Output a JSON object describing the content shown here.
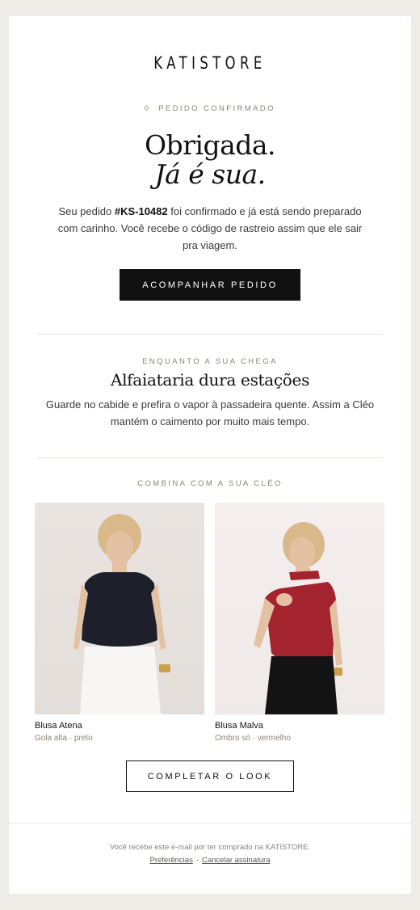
{
  "brand": {
    "logo": "KATISTORE"
  },
  "header": {
    "eyebrow": "PEDIDO CONFIRMADO",
    "title_line1": "Obrigada.",
    "title_line2": "Já é sua."
  },
  "intro": {
    "prefix": "Seu pedido ",
    "order_number": "#KS-10482",
    "suffix": " foi confirmado e já está sendo preparado com carinho. Você recebe o código de rastreio assim que ele sair pra viagem."
  },
  "actions": {
    "track_label": "ACOMPANHAR PEDIDO",
    "complete_look_label": "COMPLETAR O LOOK"
  },
  "care": {
    "eyebrow": "ENQUANTO A SUA CHEGA",
    "title": "Alfaiataria dura estações",
    "text": "Guarde no cabide e prefira o vapor à passadeira quente. Assim a Cléo mantém o caimento por muito mais tempo."
  },
  "recommendations": {
    "eyebrow": "COMBINA COM A SUA CLÉO",
    "products": [
      {
        "name": "Blusa Atena",
        "desc": "Gola alta · preto",
        "top_color": "#1d1f2b",
        "bottom_color": "#f7f6f4"
      },
      {
        "name": "Blusa Malva",
        "desc": "Ombro só · vermelho",
        "top_color": "#a3232f",
        "bottom_color": "#131313"
      }
    ]
  },
  "footer": {
    "note": "Você recebe este e-mail por ter comprado na KATISTORE.",
    "pref_label": "Preferências",
    "separator": "·",
    "unsubscribe_label": "Cancelar assinatura"
  }
}
